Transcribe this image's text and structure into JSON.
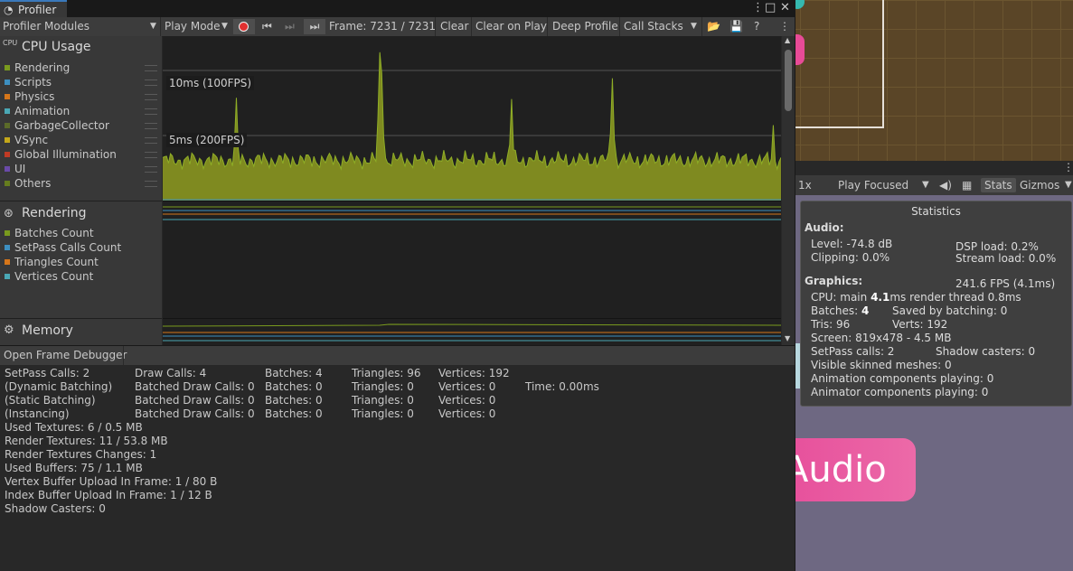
{
  "window": {
    "tab": "Profiler"
  },
  "toolbar": {
    "modules_dropdown": "Profiler Modules",
    "play_mode": "Play Mode",
    "frame": "Frame: 7231 / 7231",
    "clear": "Clear",
    "clear_on_play": "Clear on Play",
    "deep_profile": "Deep Profile",
    "call_stacks": "Call Stacks"
  },
  "cpu_module": {
    "title": "CPU Usage",
    "items": [
      {
        "label": "Rendering",
        "color": "#7a9b1e"
      },
      {
        "label": "Scripts",
        "color": "#3d8fc0"
      },
      {
        "label": "Physics",
        "color": "#d6761a"
      },
      {
        "label": "Animation",
        "color": "#4aa8b5"
      },
      {
        "label": "GarbageCollector",
        "color": "#5c6b29"
      },
      {
        "label": "VSync",
        "color": "#c4a81a"
      },
      {
        "label": "Global Illumination",
        "color": "#c03a24"
      },
      {
        "label": "UI",
        "color": "#6a4aa8"
      },
      {
        "label": "Others",
        "color": "#667d1e"
      }
    ],
    "label_10ms": "10ms (100FPS)",
    "label_5ms": "5ms (200FPS)"
  },
  "rendering_module": {
    "title": "Rendering",
    "items": [
      {
        "label": "Batches Count",
        "color": "#7a9b1e"
      },
      {
        "label": "SetPass Calls Count",
        "color": "#3d8fc0"
      },
      {
        "label": "Triangles Count",
        "color": "#d6761a"
      },
      {
        "label": "Vertices Count",
        "color": "#4aa8b5"
      }
    ]
  },
  "memory_module": {
    "title": "Memory"
  },
  "detail": {
    "open_frame_debugger": "Open Frame Debugger",
    "rows": [
      [
        "SetPass Calls: 2",
        "Draw Calls: 4",
        "Batches: 4",
        "Triangles: 96",
        "Vertices: 192",
        ""
      ],
      [
        "(Dynamic Batching)",
        "Batched Draw Calls: 0",
        "Batches: 0",
        "Triangles: 0",
        "Vertices: 0",
        "Time: 0.00ms"
      ],
      [
        "(Static Batching)",
        "Batched Draw Calls: 0",
        "Batches: 0",
        "Triangles: 0",
        "Vertices: 0",
        ""
      ],
      [
        "(Instancing)",
        "Batched Draw Calls: 0",
        "Batches: 0",
        "Triangles: 0",
        "Vertices: 0",
        ""
      ]
    ],
    "lines": [
      "Used Textures: 6 / 0.5 MB",
      "Render Textures: 11 / 53.8 MB",
      "Render Textures Changes: 1",
      "Used Buffers: 75 / 1.1 MB",
      "Vertex Buffer Upload In Frame: 1 / 80 B",
      "Index Buffer Upload In Frame: 1 / 12 B",
      "Shadow Casters: 0"
    ]
  },
  "game_toolbar": {
    "scale": "1x",
    "play_focused": "Play Focused",
    "stats": "Stats",
    "gizmos": "Gizmos"
  },
  "stats": {
    "title": "Statistics",
    "audio_header": "Audio:",
    "level": "Level: -74.8 dB",
    "clipping": "Clipping: 0.0%",
    "dsp_load": "DSP load: 0.2%",
    "stream_load": "Stream load: 0.0%",
    "graphics_header": "Graphics:",
    "fps": "241.6 FPS (4.1ms)",
    "cpu_main_prefix": "CPU: main ",
    "cpu_main_value": "4.1",
    "cpu_main_suffix": "ms  render thread 0.8ms",
    "batches_prefix": "Batches: ",
    "batches_value": "4",
    "saved_by_batching": "Saved by batching: 0",
    "tris": "Tris: 96",
    "verts": "Verts: 192",
    "screen": "Screen: 819x478 - 4.5 MB",
    "setpass": "SetPass calls: 2",
    "shadow_casters": "Shadow casters: 0",
    "visible_skinned": "Visible skinned meshes: 0",
    "animation_components": "Animation components playing: 0",
    "animator_components": "Animator components playing: 0"
  },
  "game_view": {
    "audio_button": "Audio"
  },
  "chart_data": {
    "type": "area",
    "title": "CPU Usage",
    "xlabel": "",
    "ylabel": "",
    "ylim": [
      0,
      12.5
    ],
    "reference_lines": [
      {
        "label": "10ms (100FPS)",
        "value": 10
      },
      {
        "label": "5ms (200FPS)",
        "value": 5
      }
    ],
    "frames": 320,
    "baseline_ms": 3.1,
    "spikes": [
      {
        "frame": 38,
        "ms": 7.9
      },
      {
        "frame": 112,
        "ms": 11.4
      },
      {
        "frame": 113,
        "ms": 9.8
      },
      {
        "frame": 180,
        "ms": 7.8
      },
      {
        "frame": 232,
        "ms": 9.4
      },
      {
        "frame": 315,
        "ms": 5.8
      }
    ]
  }
}
